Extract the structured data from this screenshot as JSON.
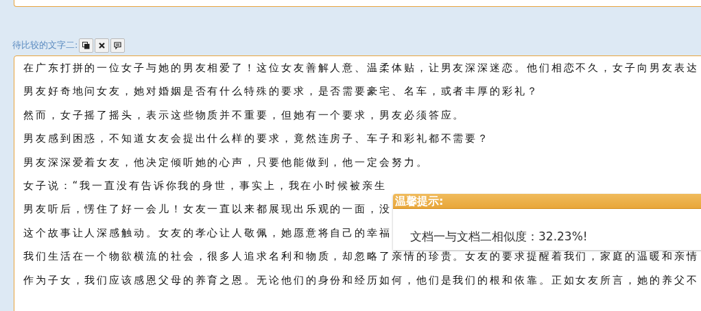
{
  "compare_label": "待比较的文字二:",
  "toolbar": [
    {
      "kind": "copy"
    },
    {
      "kind": "clear"
    },
    {
      "kind": "comment"
    }
  ],
  "text_lines": [
    "在广东打拼的一位女子与她的男友相爱了！这位女友善解人意、温柔体贴，让男友深深迷恋。他们相恋不久，女子向男友表达",
    "男友好奇地问女友，她对婚姻是否有什么特殊的要求，是否需要豪宅、名车，或者丰厚的彩礼？",
    "然而，女子摇了摇头，表示这些物质并不重要，但她有一个要求，男友必须答应。",
    "男友感到困惑，不知道女友会提出什么样的要求，竟然连房子、车子和彩礼都不需要？",
    "男友深深爱着女友，他决定倾听她的心声，只要他能做到，他一定会努力。",
    "女子说：“我一直没有告诉你我的身世，事实上，我在小时候被亲生",
    "男友听后，愣住了好一会儿！女友一直以来都展现出乐观的一面，没",
    "这个故事让人深感触动。女友的孝心让人敬佩，她愿意将自己的幸福",
    "我们生活在一个物欲横流的社会，很多人追求名利和物质，却忽略了亲情的珍贵。女友的要求提醒着我们，家庭的温暖和亲情",
    "作为子女，我们应该感恩父母的养育之恩。无论他们的身份和经历如何，他们是我们的根和依靠。正如女友所言，她的养父不"
  ],
  "dialog": {
    "title": "温馨提示:",
    "message": "文档一与文档二相似度：32.23%!"
  }
}
